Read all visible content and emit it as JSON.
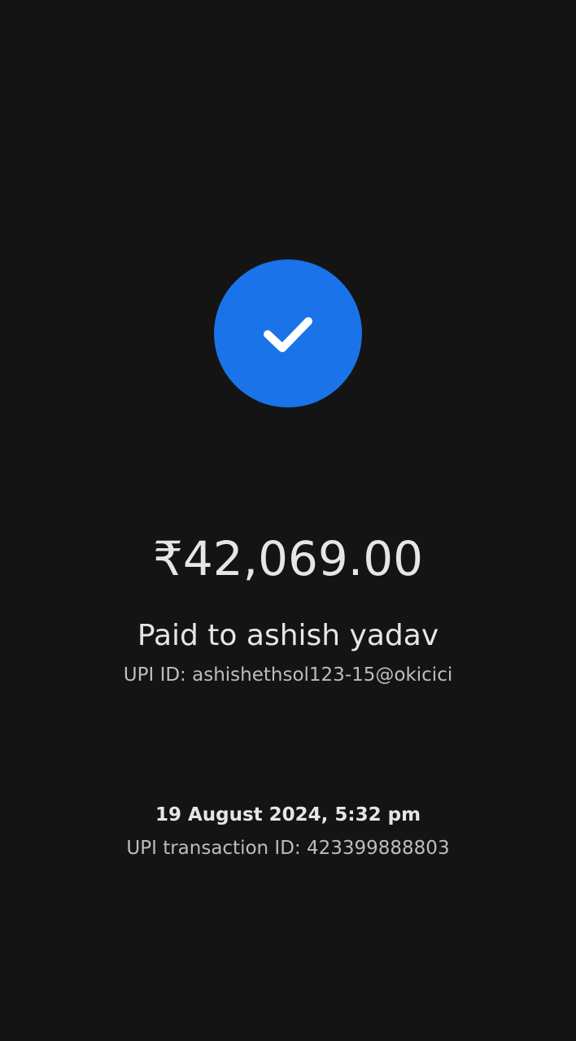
{
  "status": {
    "icon": "checkmark-icon",
    "circle_color": "#1a73e8"
  },
  "payment": {
    "amount": "₹42,069.00",
    "paid_to": "Paid to ashish yadav",
    "upi_id": "UPI ID: ashishethsol123-15@okicici"
  },
  "transaction": {
    "datetime": "19 August 2024, 5:32 pm",
    "upi_transaction_id": "UPI transaction ID: 423399888803"
  },
  "colors": {
    "background": "#141414",
    "accent": "#1a73e8",
    "primary_text": "#e6e6e6",
    "secondary_text": "#bdbdbd"
  }
}
